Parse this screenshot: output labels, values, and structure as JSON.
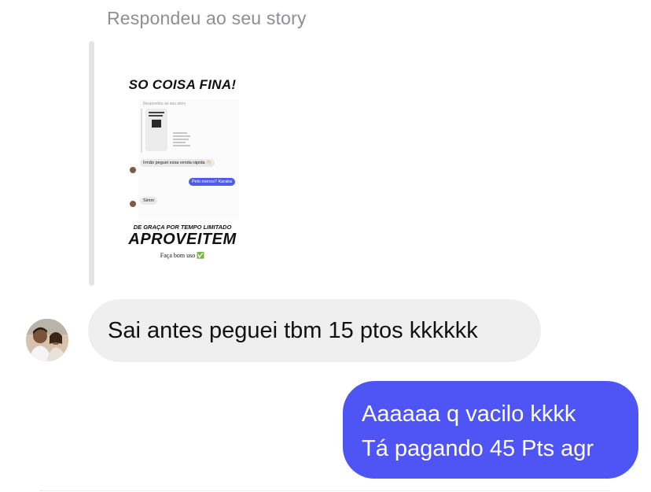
{
  "conversation": {
    "reply_caption": "Respondeu ao seu story",
    "story": {
      "headline": "SO COISA FINA!",
      "nested_caption": "Respondeu ao seu story",
      "nested_bubble_1": "Irmão peguei essa venda rápida 👏🏻",
      "nested_bubble_2": "Pelo menos? Karaka",
      "nested_bubble_3": "Simm",
      "promo_line": "DE GRAÇA POR TEMPO LIMITADO",
      "cta": "APROVEITEM",
      "footer": "Faça bom uso ✅"
    },
    "messages": [
      {
        "direction": "incoming",
        "text": "Sai antes peguei tbm 15 ptos kkkkkk"
      },
      {
        "direction": "outgoing",
        "lines": [
          "Aaaaaa q vacilo kkkk",
          "Tá pagando 45 Pts agr"
        ]
      }
    ]
  },
  "colors": {
    "outgoing_bubble": "#4e55f4",
    "incoming_bubble": "#efefef",
    "caption_gray": "#8e8e93"
  }
}
